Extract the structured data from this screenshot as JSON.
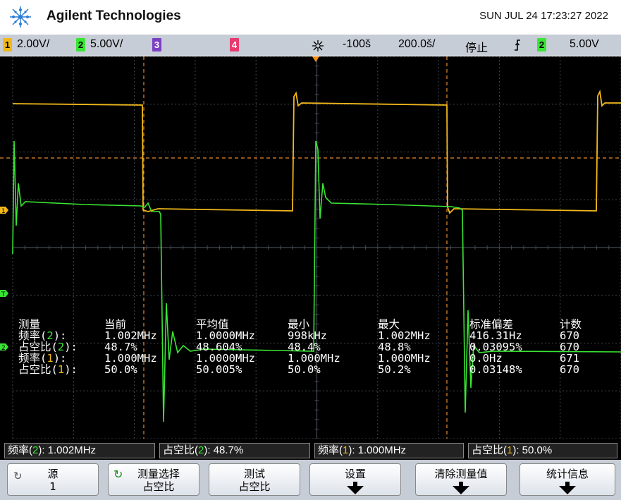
{
  "header": {
    "brand": "Agilent Technologies",
    "datetime": "SUN JUL 24 17:23:27 2022"
  },
  "status_bar": {
    "ch1_num": "1",
    "ch1_scale": "2.00V/",
    "ch2_num": "2",
    "ch2_scale": "5.00V/",
    "ch3_num": "3",
    "ch4_num": "4",
    "time_offset": "-100š",
    "time_scale": "200.0š/",
    "run_state": "停止",
    "trigger_source_num": "2",
    "trigger_level": "5.00V"
  },
  "colors": {
    "ch1": "#f2b81a",
    "ch2": "#39e633",
    "ch3": "#7c3fc4",
    "ch4": "#e63b6f",
    "grid": "#444a52"
  },
  "markers": {
    "ch1": "1",
    "ch2": "2",
    "trigger": "T"
  },
  "measurements": {
    "headers": [
      "测量",
      "当前",
      "平均值",
      "最小",
      "最大",
      "标准偏差",
      "计数"
    ],
    "rows": [
      {
        "label_a": "频率(",
        "ch": "2",
        "label_b": "):",
        "current": "1.002MHz",
        "mean": "1.0000MHz",
        "min": "998kHz",
        "max": "1.002MHz",
        "std": "416.31Hz",
        "count": "670"
      },
      {
        "label_a": "占空比(",
        "ch": "2",
        "label_b": "):",
        "current": "48.7%",
        "mean": "48.604%",
        "min": "48.4%",
        "max": "48.8%",
        "std": "0.03095%",
        "count": "670"
      },
      {
        "label_a": "频率(",
        "ch": "1",
        "label_b": "):",
        "current": "1.000MHz",
        "mean": "1.0000MHz",
        "min": "1.000MHz",
        "max": "1.000MHz",
        "std": "0.0Hz",
        "count": "671"
      },
      {
        "label_a": "占空比(",
        "ch": "1",
        "label_b": "):",
        "current": "50.0%",
        "mean": "50.005%",
        "min": "50.0%",
        "max": "50.2%",
        "std": "0.03148%",
        "count": "670"
      }
    ]
  },
  "summary_bar": [
    {
      "label_a": "频率(",
      "ch": "2",
      "label_b": "): 1.002MHz"
    },
    {
      "label_a": "占空比(",
      "ch": "2",
      "label_b": "): 48.7%"
    },
    {
      "label_a": "频率(",
      "ch": "1",
      "label_b": "): 1.000MHz"
    },
    {
      "label_a": "占空比(",
      "ch": "1",
      "label_b": "): 50.0%"
    }
  ],
  "softkeys": {
    "source_label": "源",
    "source_value": "1",
    "select_label": "测量选择",
    "select_value": "占空比",
    "test_label": "测试",
    "test_value": "占空比",
    "settings_label": "设置",
    "clear_label": "清除测量值",
    "stats_label": "统计信息"
  }
}
